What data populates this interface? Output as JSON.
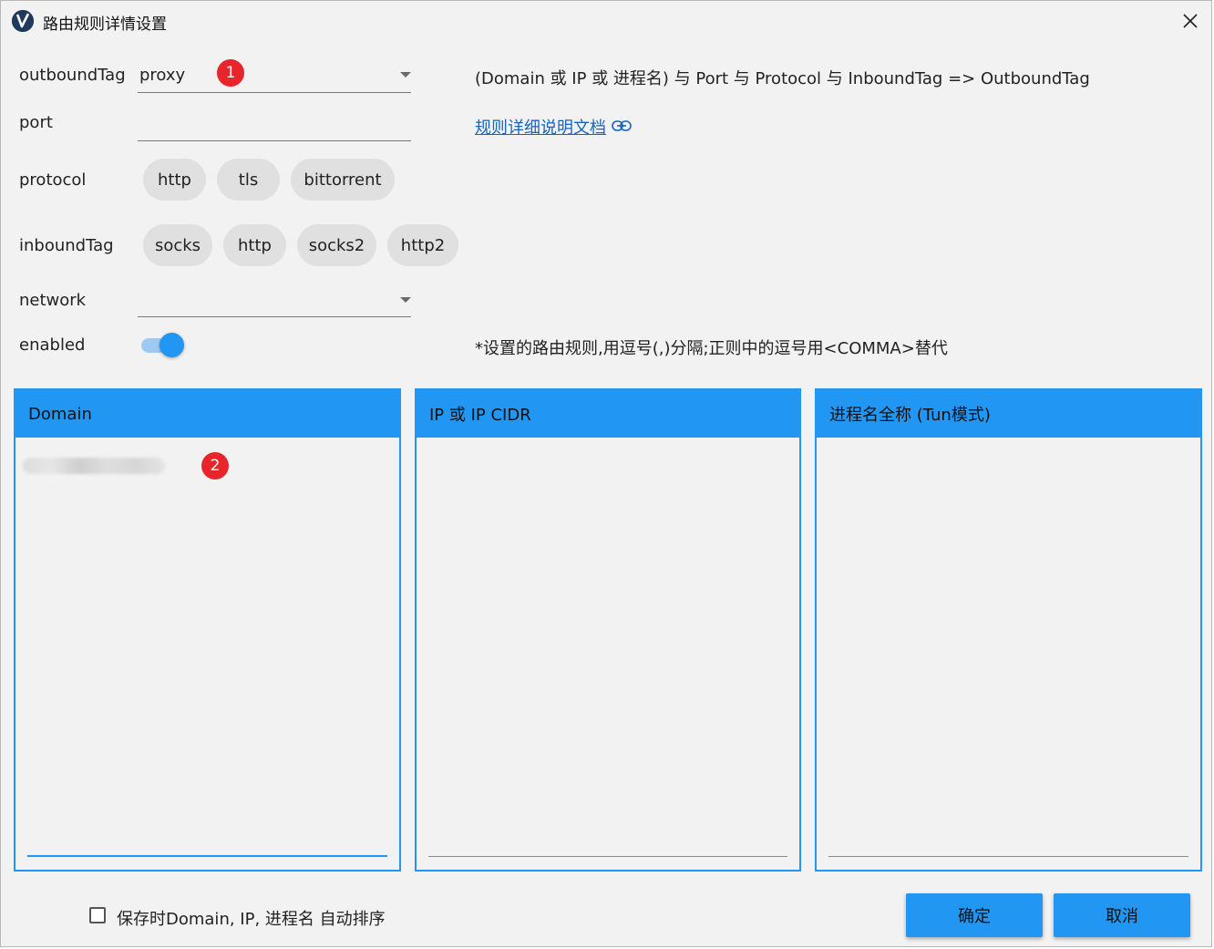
{
  "window": {
    "title": "路由规则详情设置"
  },
  "form": {
    "outbound_tag": {
      "label": "outboundTag",
      "value": "proxy",
      "badge": "1"
    },
    "port": {
      "label": "port",
      "value": ""
    },
    "protocol": {
      "label": "protocol",
      "options": [
        "http",
        "tls",
        "bittorrent"
      ]
    },
    "inbound_tag": {
      "label": "inboundTag",
      "options": [
        "socks",
        "http",
        "socks2",
        "http2"
      ]
    },
    "network": {
      "label": "network",
      "value": ""
    },
    "enabled": {
      "label": "enabled",
      "value": true
    }
  },
  "info": {
    "formula": "(Domain 或 IP 或 进程名) 与 Port 与 Protocol 与 InboundTag => OutboundTag",
    "doc_link": "规则详细说明文档",
    "hint": "*设置的路由规则,用逗号(,)分隔;正则中的逗号用<COMMA>替代"
  },
  "panels": [
    {
      "header": "Domain",
      "badge": "2"
    },
    {
      "header": "IP 或 IP CIDR"
    },
    {
      "header": "进程名全称 (Tun模式)"
    }
  ],
  "footer": {
    "auto_sort_label": "保存时Domain, IP, 进程名 自动排序",
    "auto_sort_checked": false,
    "confirm": "确定",
    "cancel": "取消"
  },
  "colors": {
    "accent": "#2196f3",
    "badge": "#e8252b",
    "link": "#1565c0"
  }
}
